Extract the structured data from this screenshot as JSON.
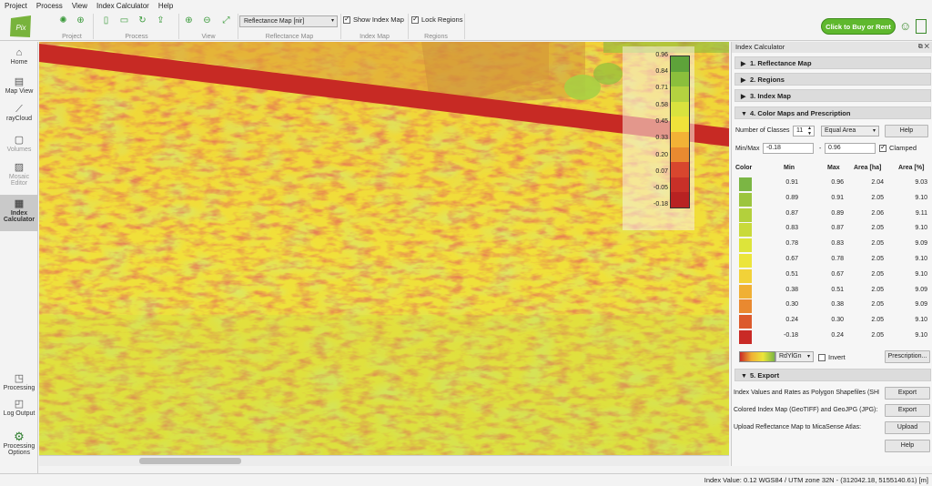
{
  "menu": [
    "Project",
    "Process",
    "View",
    "Index Calculator",
    "Help"
  ],
  "toolbar": {
    "groups": [
      "Project",
      "Process",
      "View",
      "Reflectance Map",
      "Index Map",
      "Regions"
    ],
    "map_select": "Reflectance Map [nir]",
    "show_index_map": "Show Index Map",
    "lock_regions": "Lock Regions",
    "buy_button": "Click to Buy or Rent"
  },
  "sidebar": {
    "top": [
      "Home",
      "Map View",
      "rayCloud",
      "Volumes",
      "Mosaic Editor",
      "Index Calculator"
    ],
    "bottom": [
      "Processing",
      "Log Output",
      "Processing Options"
    ]
  },
  "legend": {
    "labels": [
      "0.96",
      "0.84",
      "0.71",
      "0.58",
      "0.45",
      "0.33",
      "0.20",
      "0.07",
      "-0.05",
      "-0.18"
    ],
    "colors": [
      "#5ea33a",
      "#8bbf3c",
      "#b4d240",
      "#d9e23e",
      "#f0e23a",
      "#f2b236",
      "#e98a30",
      "#d8462e",
      "#c83028",
      "#b82222"
    ]
  },
  "panel": {
    "title": "Index Calculator",
    "sections": {
      "s1": "1. Reflectance Map",
      "s2": "2. Regions",
      "s3": "3. Index Map",
      "s4": "4. Color Maps and Prescription",
      "s5": "5. Export"
    },
    "num_classes_label": "Number of Classes",
    "num_classes": "11",
    "method": "Equal Area",
    "help": "Help",
    "minmax_label": "Min/Max",
    "min": "-0.18",
    "dash": "-",
    "max": "0.96",
    "clamped": "Clamped",
    "headers": [
      "Color",
      "Min",
      "Max",
      "Area [ha]",
      "Area [%]"
    ],
    "rows": [
      {
        "color": "#7bb644",
        "min": "0.91",
        "max": "0.96",
        "ha": "2.04",
        "pct": "9.03"
      },
      {
        "color": "#9cc53e",
        "min": "0.89",
        "max": "0.91",
        "ha": "2.05",
        "pct": "9.10"
      },
      {
        "color": "#b3d03c",
        "min": "0.87",
        "max": "0.89",
        "ha": "2.06",
        "pct": "9.11"
      },
      {
        "color": "#c9da3a",
        "min": "0.83",
        "max": "0.87",
        "ha": "2.05",
        "pct": "9.10"
      },
      {
        "color": "#dde43a",
        "min": "0.78",
        "max": "0.83",
        "ha": "2.05",
        "pct": "9.09"
      },
      {
        "color": "#ece53a",
        "min": "0.67",
        "max": "0.78",
        "ha": "2.05",
        "pct": "9.10"
      },
      {
        "color": "#f2d238",
        "min": "0.51",
        "max": "0.67",
        "ha": "2.05",
        "pct": "9.10"
      },
      {
        "color": "#f0b034",
        "min": "0.38",
        "max": "0.51",
        "ha": "2.05",
        "pct": "9.09"
      },
      {
        "color": "#e98930",
        "min": "0.30",
        "max": "0.38",
        "ha": "2.05",
        "pct": "9.09"
      },
      {
        "color": "#dc5a2c",
        "min": "0.24",
        "max": "0.30",
        "ha": "2.05",
        "pct": "9.10"
      },
      {
        "color": "#c92a26",
        "min": "-0.18",
        "max": "0.24",
        "ha": "2.05",
        "pct": "9.10"
      }
    ],
    "colormap": "RdYlGn",
    "invert": "Invert",
    "prescription": "Prescription...",
    "export_rows": [
      {
        "label": "Index Values and Rates as Polygon Shapefiles (SHI",
        "btn": "Export"
      },
      {
        "label": "Colored Index Map (GeoTIFF) and GeoJPG (JPG):",
        "btn": "Export"
      },
      {
        "label": "Upload Reflectance Map to MicaSense Atlas:",
        "btn": "Upload"
      }
    ],
    "export_help": "Help"
  },
  "status": "Index Value: 0.12   WGS84 / UTM zone 32N  - (312042.18, 5155140.61) [m]"
}
